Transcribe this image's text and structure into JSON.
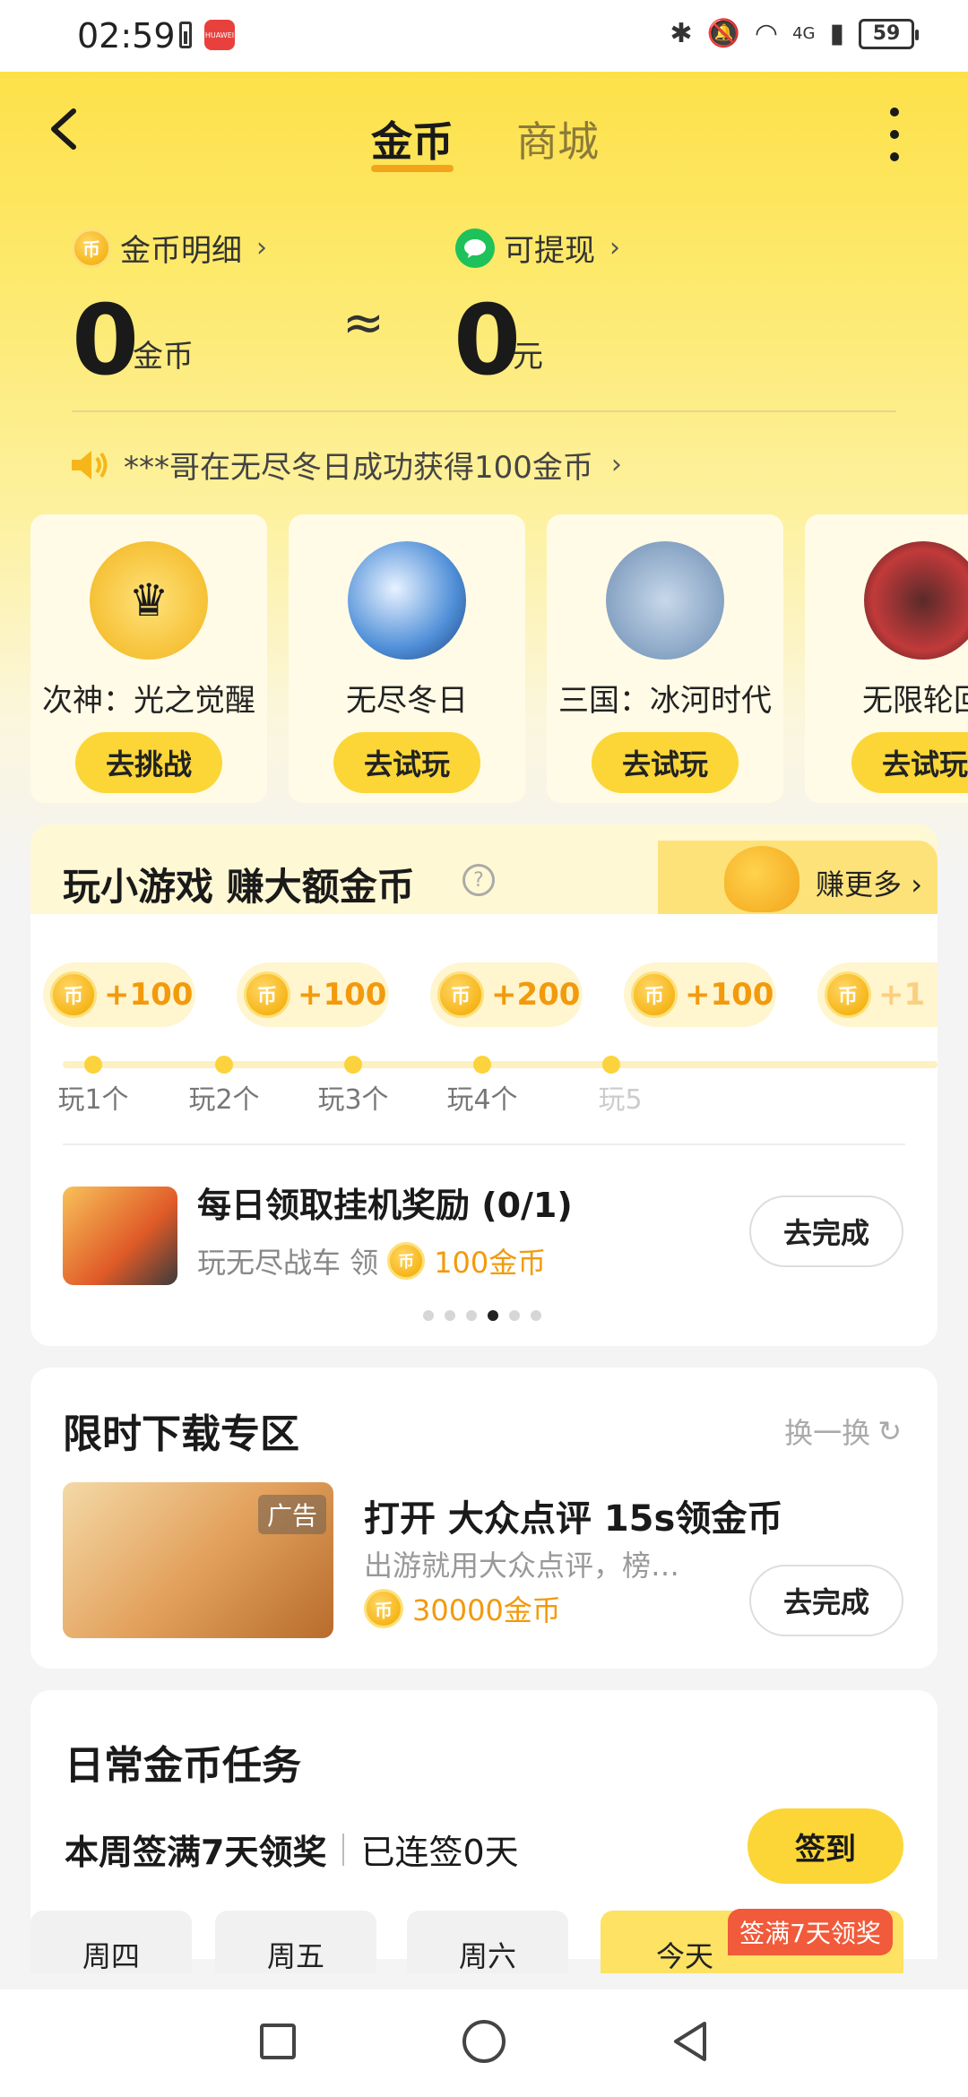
{
  "status_bar": {
    "time": "02:59",
    "battery": "59",
    "network": "4G",
    "app_badge": "HUAWEI"
  },
  "nav": {
    "tabs": [
      {
        "label": "金币",
        "active": true
      },
      {
        "label": "商城",
        "active": false
      }
    ]
  },
  "balance": {
    "coins_label": "金币明细",
    "coins_value": "0",
    "coins_unit": "金币",
    "approx_symbol": "≈",
    "cash_label": "可提现",
    "cash_value": "0",
    "cash_unit": "元"
  },
  "ticker": {
    "text": "***哥在无尽冬日成功获得100金币"
  },
  "games": [
    {
      "name": "次神：光之觉醒",
      "button": "去挑战",
      "icon": "crown-hero-icon",
      "color": "#f8c94a"
    },
    {
      "name": "无尽冬日",
      "button": "去试玩",
      "icon": "globe-icon",
      "color": "#3d7fcf"
    },
    {
      "name": "三国：冰河时代",
      "button": "去试玩",
      "icon": "warrior-icon",
      "color": "#7aa7d6"
    },
    {
      "name": "无限轮回",
      "button": "去试玩",
      "icon": "monster-icon",
      "color": "#c23a3a"
    }
  ],
  "mini_games": {
    "title": "玩小游戏 赚大额金币",
    "earn_more": "赚更多",
    "rewards": [
      {
        "value": "+100",
        "label": "玩1个"
      },
      {
        "value": "+100",
        "label": "玩2个"
      },
      {
        "value": "+200",
        "label": "玩3个"
      },
      {
        "value": "+100",
        "label": "玩4个"
      },
      {
        "value": "+1",
        "label": "玩5"
      }
    ],
    "task": {
      "title": "每日领取挂机奖励 (0/1)",
      "subtitle": "玩无尽战车 领",
      "reward": "100金币",
      "button": "去完成"
    },
    "pager": {
      "count": 6,
      "active": 3
    }
  },
  "download": {
    "title": "限时下载专区",
    "refresh": "换一换",
    "ad_tag": "广告",
    "ad_title": "打开 大众点评 15s领金币",
    "ad_desc": "出游就用大众点评，榜…",
    "ad_reward": "30000金币",
    "button": "去完成"
  },
  "daily": {
    "title": "日常金币任务",
    "signin_title": "本周签满7天领奖",
    "signin_status": "已连签0天",
    "sign_button": "签到",
    "streak_badge": "签满7天领奖",
    "days": [
      "周四",
      "周五",
      "周六",
      "今天"
    ]
  },
  "colors": {
    "accent": "#fbd636",
    "coin_orange": "#f29a0c",
    "badge_red": "#f15a3a"
  }
}
